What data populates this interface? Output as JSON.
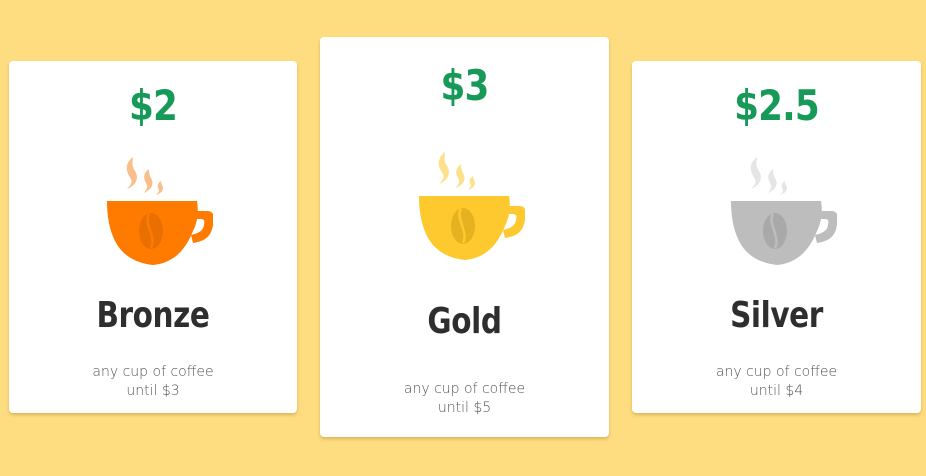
{
  "plans": [
    {
      "price": "$2",
      "name": "Bronze",
      "desc_line1": "any cup of coffee",
      "desc_line2": "until $3",
      "cup_color": "#ff7b00",
      "steam_color": "#f9bf8a",
      "bean_color": "#e86f00"
    },
    {
      "price": "$3",
      "name": "Gold",
      "desc_line1": "any cup of coffee",
      "desc_line2": "until $5",
      "cup_color": "#fdc92e",
      "steam_color": "#fde08a",
      "bean_color": "#e6b320"
    },
    {
      "price": "$2.5",
      "name": "Silver",
      "desc_line1": "any cup of coffee",
      "desc_line2": "until $4",
      "cup_color": "#bdbdbd",
      "steam_color": "#e5e5e5",
      "bean_color": "#a9a9a9"
    }
  ],
  "colors": {
    "background": "#fedd80",
    "price": "#179958",
    "name": "#2e2e2e"
  }
}
